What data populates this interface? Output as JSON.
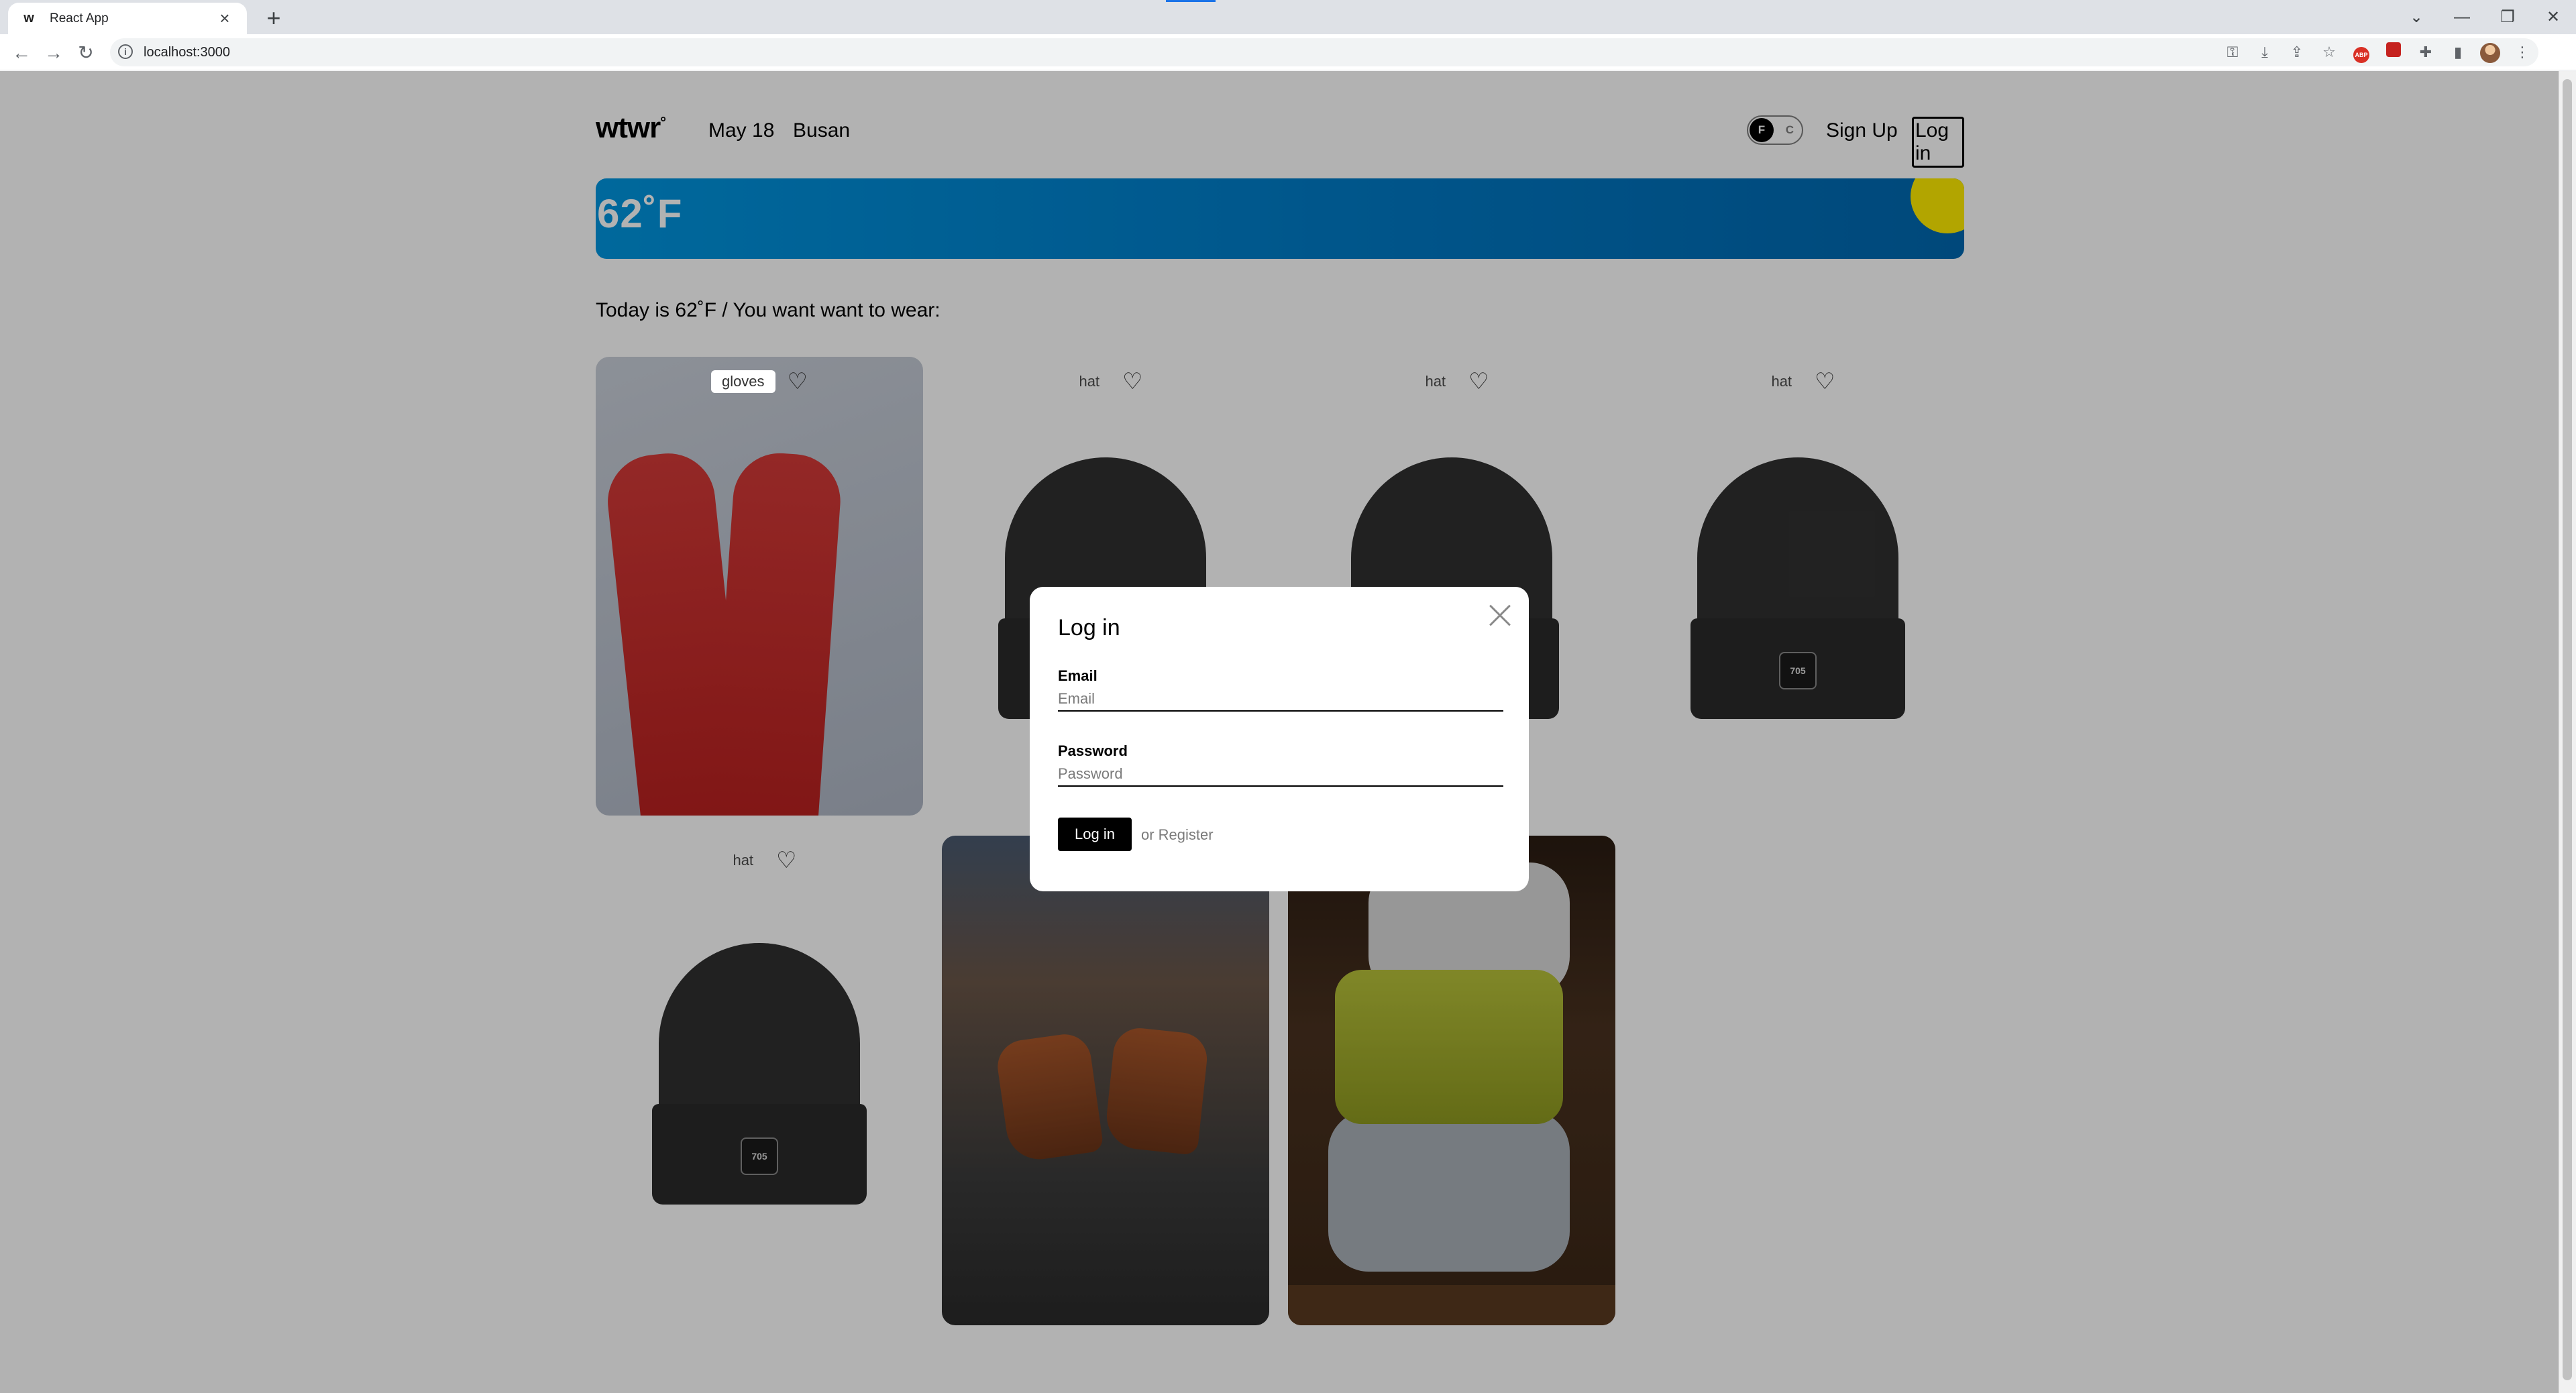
{
  "browser": {
    "tab_title": "React App",
    "tab_favicon": "wtwr",
    "new_tab": "+",
    "url": "localhost:3000",
    "window_controls": {
      "collapse": "⌄",
      "minimize": "—",
      "restore": "❐",
      "close": "✕"
    },
    "nav": {
      "back": "←",
      "forward": "→",
      "reload": "↻"
    },
    "toolbar_icons": [
      "key-icon",
      "install-icon",
      "share-icon",
      "star-icon",
      "adblock-extension-icon",
      "red-extension-icon",
      "puzzle-extension-icon",
      "side-panel-icon",
      "profile-avatar",
      "menu-icon"
    ]
  },
  "header": {
    "logo": "wtwr",
    "logo_mark": "°",
    "date": "May 18",
    "city": "Busan",
    "toggle": {
      "active": "F",
      "inactive": "C"
    },
    "signup": "Sign Up",
    "login": "Log in"
  },
  "weather": {
    "temperature": "62˚F",
    "sun_color": "#ffec00",
    "banner_color": "#0079c4"
  },
  "today_text": "Today is 62˚F / You want want to wear:",
  "cards": [
    {
      "name": "gloves",
      "image": "red-gloves"
    },
    {
      "name": "hat",
      "image": "black-beanie"
    },
    {
      "name": "hat",
      "image": "black-beanie"
    },
    {
      "name": "hat",
      "image": "black-beanie"
    },
    {
      "name": "hat",
      "image": "black-beanie"
    },
    {
      "name": "",
      "image": "brown-boots"
    },
    {
      "name": "",
      "image": "stacked-scarves"
    }
  ],
  "beanie_patch": "705",
  "modal": {
    "title": "Log in",
    "email_label": "Email",
    "email_placeholder": "Email",
    "email_value": "",
    "password_label": "Password",
    "password_placeholder": "Password",
    "password_value": "",
    "submit_label": "Log in",
    "alt_link": "or Register"
  },
  "colors": {
    "overlay": "rgba(0,0,0,0.30)",
    "primary": "#000000",
    "muted": "#7a7a7a"
  }
}
